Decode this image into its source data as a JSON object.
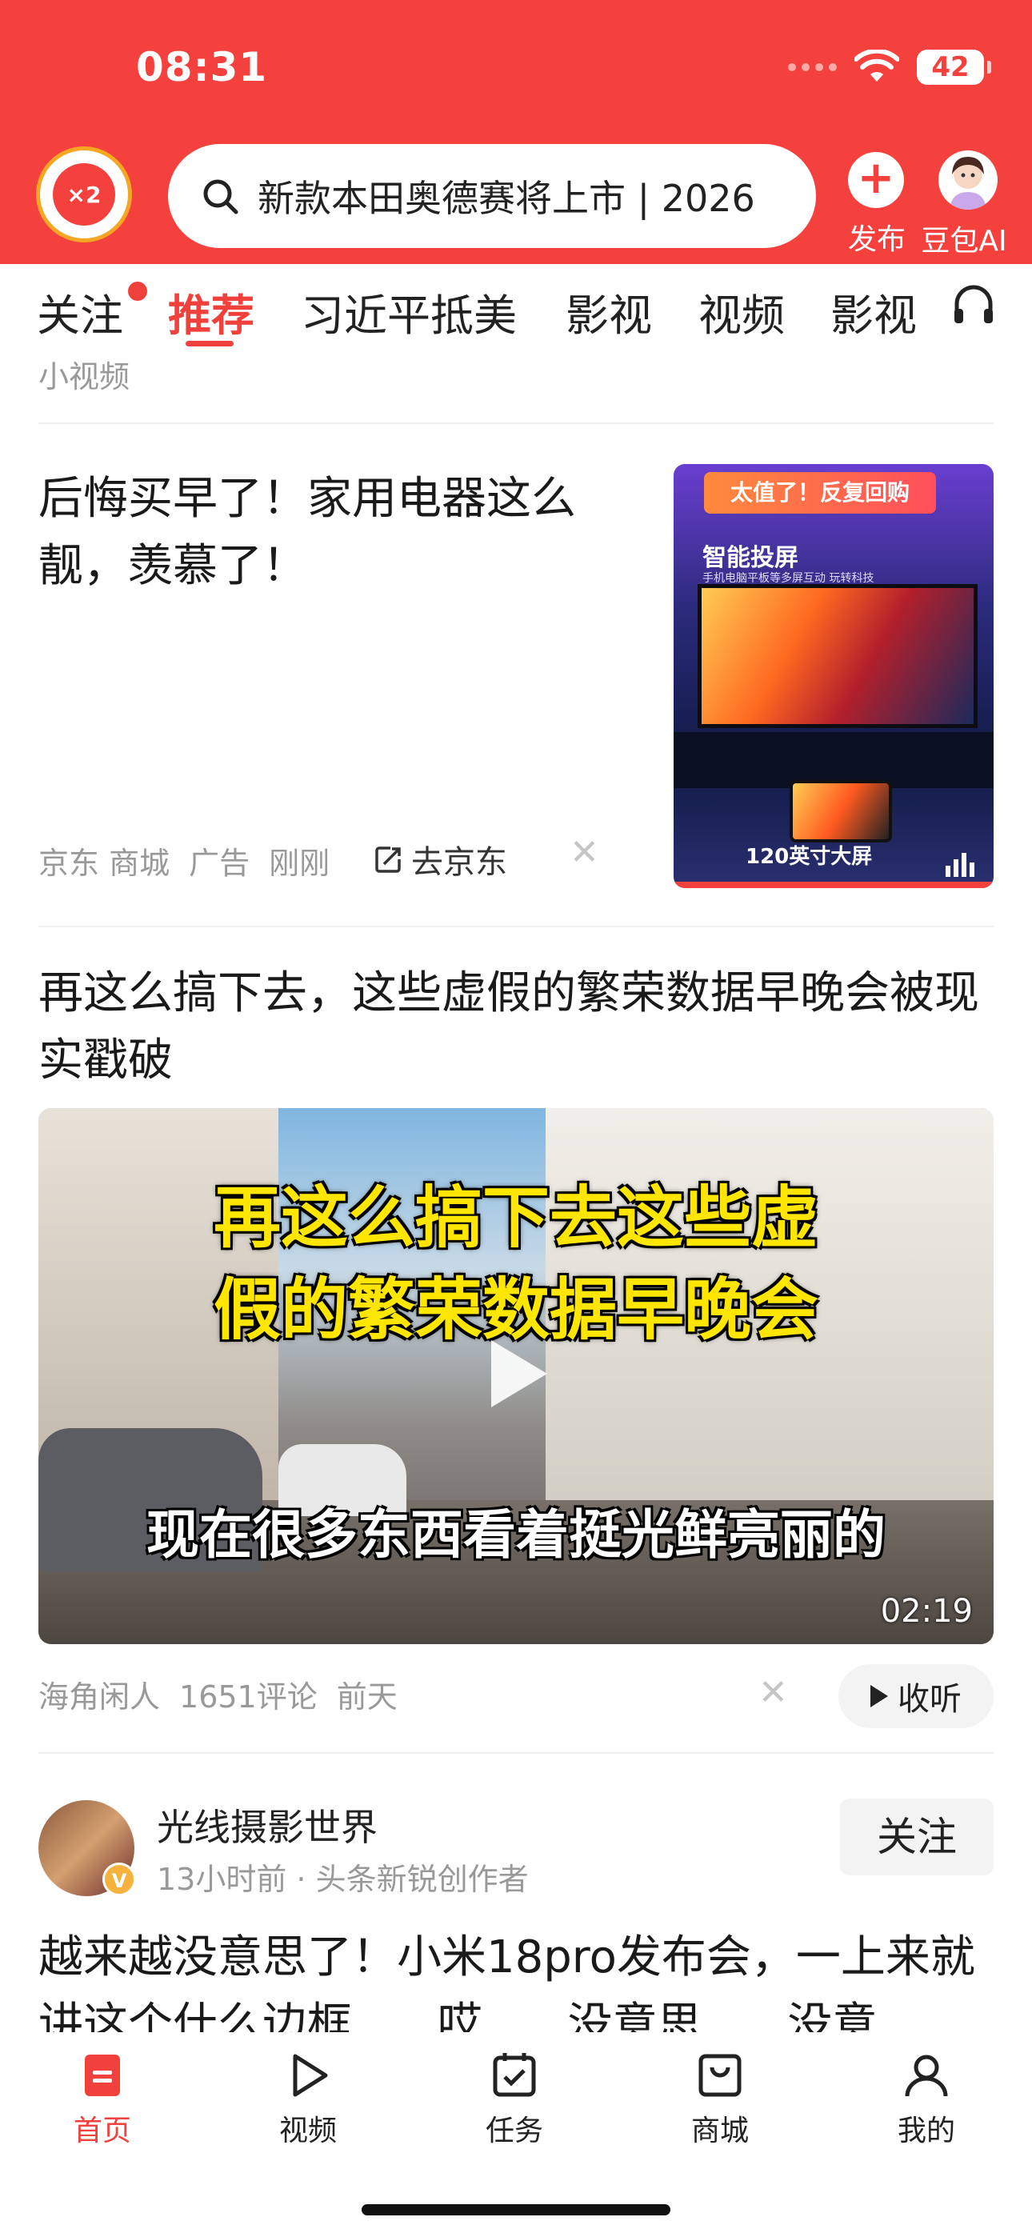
{
  "status_bar": {
    "time": "08:31",
    "battery": "42"
  },
  "header": {
    "logo_badge": "×2",
    "search_text": "新款本田奥德赛将上市 | 2026",
    "publish_label": "发布",
    "doubao_label": "豆包AI"
  },
  "tabs": [
    "关注",
    "推荐",
    "习近平抵美",
    "影视",
    "视频",
    "影视"
  ],
  "active_tab": "推荐",
  "sub_label": "小视频",
  "ad": {
    "title": "后悔买早了！家用电器这么靓，羡慕了！",
    "source": "京东 商城",
    "tag": "广告",
    "time": "刚刚",
    "cta": "去京东",
    "image": {
      "banner": "太值了！反复回购",
      "caption": "智能投屏",
      "sub": "手机电脑平板等多屏互动 玩转科技",
      "size_text": "120英寸大屏"
    }
  },
  "video_post": {
    "title": "再这么搞下去，这些虚假的繁荣数据早晚会被现实戳破",
    "overlay_line1": "再这么搞下去这些虚",
    "overlay_line2": "假的繁荣数据早晚会",
    "overlay_line3": "现在很多东西看着挺光鲜亮丽的",
    "duration": "02:19",
    "author": "海角闲人",
    "comments": "1651评论",
    "time": "前天",
    "listen_label": "收听"
  },
  "author_post": {
    "name": "光线摄影世界",
    "meta": "13小时前 · 头条新锐创作者",
    "follow_label": "关注",
    "text": "越来越没意思了！小米18pro发布会，一上来就讲这个什么边框......哎......没意思......没意"
  },
  "bottom_nav": [
    {
      "label": "首页",
      "icon": "home-icon"
    },
    {
      "label": "视频",
      "icon": "video-play-icon"
    },
    {
      "label": "任务",
      "icon": "task-check-icon"
    },
    {
      "label": "商城",
      "icon": "shopping-bag-icon"
    },
    {
      "label": "我的",
      "icon": "person-icon"
    }
  ],
  "colors": {
    "brand_red": "#f5413d",
    "active_red": "#f0413d",
    "muted": "#999999"
  }
}
